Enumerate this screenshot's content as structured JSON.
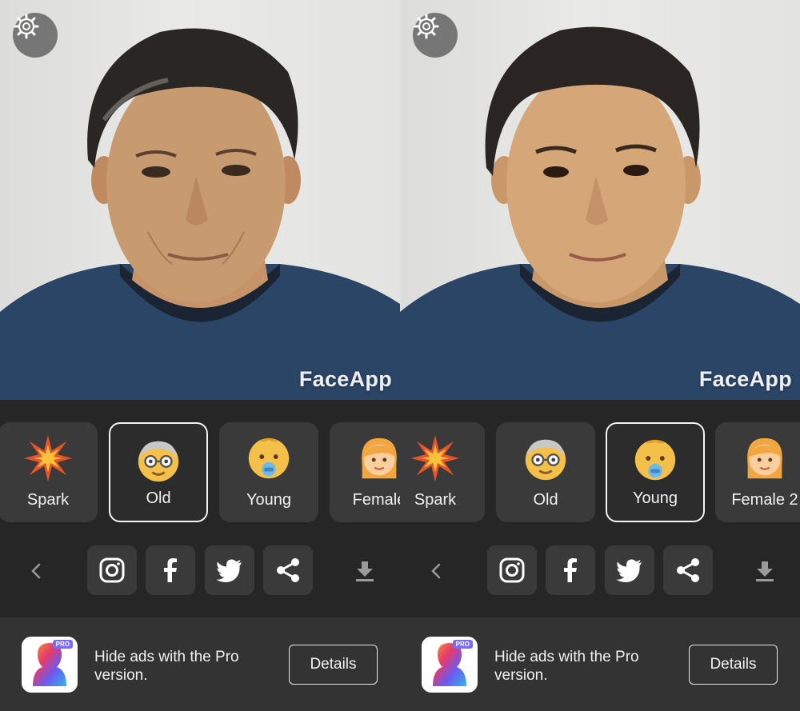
{
  "watermark": "FaceApp",
  "filter_labels": {
    "spark": "Spark",
    "old": "Old",
    "young": "Young",
    "female": "Female",
    "female_2": "Female 2"
  },
  "left_panel": {
    "selected_filter": "Old",
    "filters": [
      "Spark",
      "Old",
      "Young",
      "Female"
    ]
  },
  "right_panel": {
    "selected_filter": "Young",
    "filters": [
      "Spark",
      "Old",
      "Young",
      "Female 2"
    ]
  },
  "share_icons": [
    "back-icon",
    "instagram-icon",
    "facebook-icon",
    "twitter-icon",
    "share-icon",
    "download-icon"
  ],
  "ad": {
    "text": "Hide ads with the Pro version.",
    "button": "Details",
    "badge": "PRO"
  },
  "colors": {
    "background": "#262626",
    "tile": "#3a3a3a",
    "ad_background": "#333333",
    "selected_border": "#f2f2f2",
    "shirt": "#2b4566"
  }
}
